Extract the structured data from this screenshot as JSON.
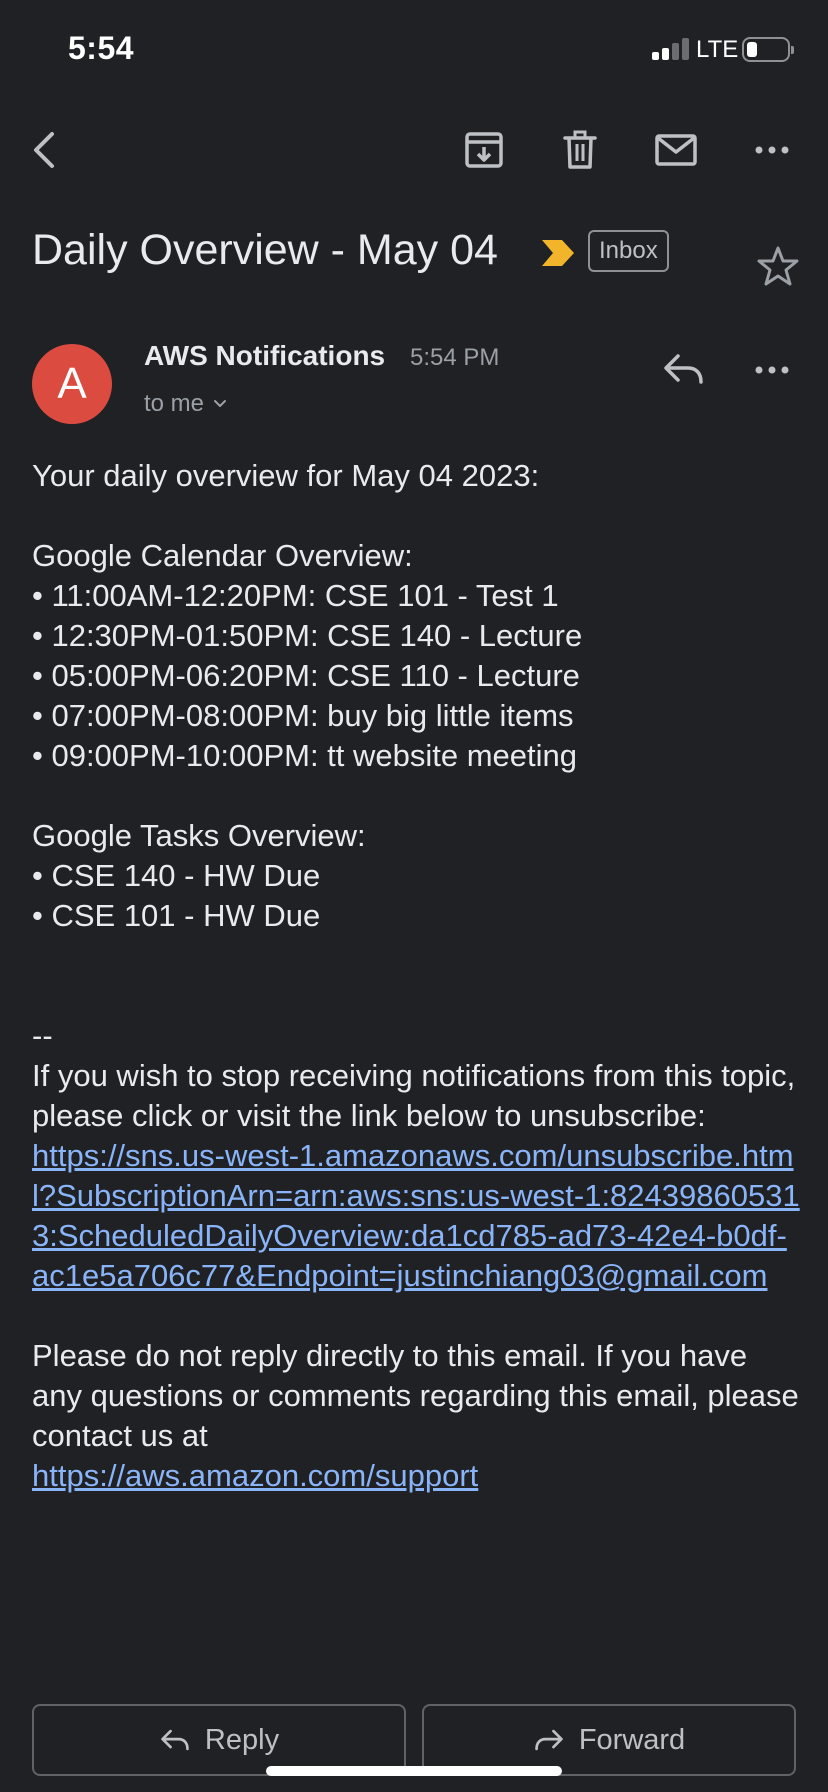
{
  "status_bar": {
    "time": "5:54",
    "network": "LTE",
    "battery_level": 0.2
  },
  "toolbar": {
    "icons": [
      "back-arrow-icon",
      "archive-icon",
      "trash-icon",
      "mail-icon",
      "more-horizontal-icon"
    ]
  },
  "email": {
    "subject": "Daily Overview - May 04",
    "label": "Inbox",
    "importance_color": "#f2b42b",
    "sender": {
      "initial": "A",
      "name": "AWS Notifications",
      "time": "5:54 PM",
      "recipient": "to me",
      "avatar_color": "#db4b3f"
    },
    "body": {
      "intro": "Your daily overview for May 04 2023:",
      "calendar_heading": "Google Calendar Overview:",
      "calendar_items": [
        "• 11:00AM-12:20PM: CSE 101 - Test 1",
        "• 12:30PM-01:50PM: CSE 140 - Lecture",
        "• 05:00PM-06:20PM: CSE 110 - Lecture",
        "• 07:00PM-08:00PM: buy big little items",
        "• 09:00PM-10:00PM: tt website meeting"
      ],
      "tasks_heading": "Google Tasks Overview:",
      "task_items": [
        "• CSE 140 - HW Due",
        "• CSE 101 - HW Due"
      ],
      "separator": "--",
      "unsubscribe_text": "If you wish to stop receiving notifications from this topic, please click or visit the link below to unsubscribe:",
      "unsubscribe_link": "https://sns.us-west-1.amazonaws.com/unsubscribe.html?SubscriptionArn=arn:aws:sns:us-west-1:824398605313:ScheduledDailyOverview:da1cd785-ad73-42e4-b0df-ac1e5a706c77&Endpoint=justinchiang03@gmail.com",
      "support_text": "Please do not reply directly to this email. If you have any questions or comments regarding this email, please contact us at",
      "support_link": "https://aws.amazon.com/support"
    }
  },
  "actions": {
    "reply_label": "Reply",
    "forward_label": "Forward"
  },
  "colors": {
    "background": "#202124",
    "link": "#8ab4f8"
  }
}
